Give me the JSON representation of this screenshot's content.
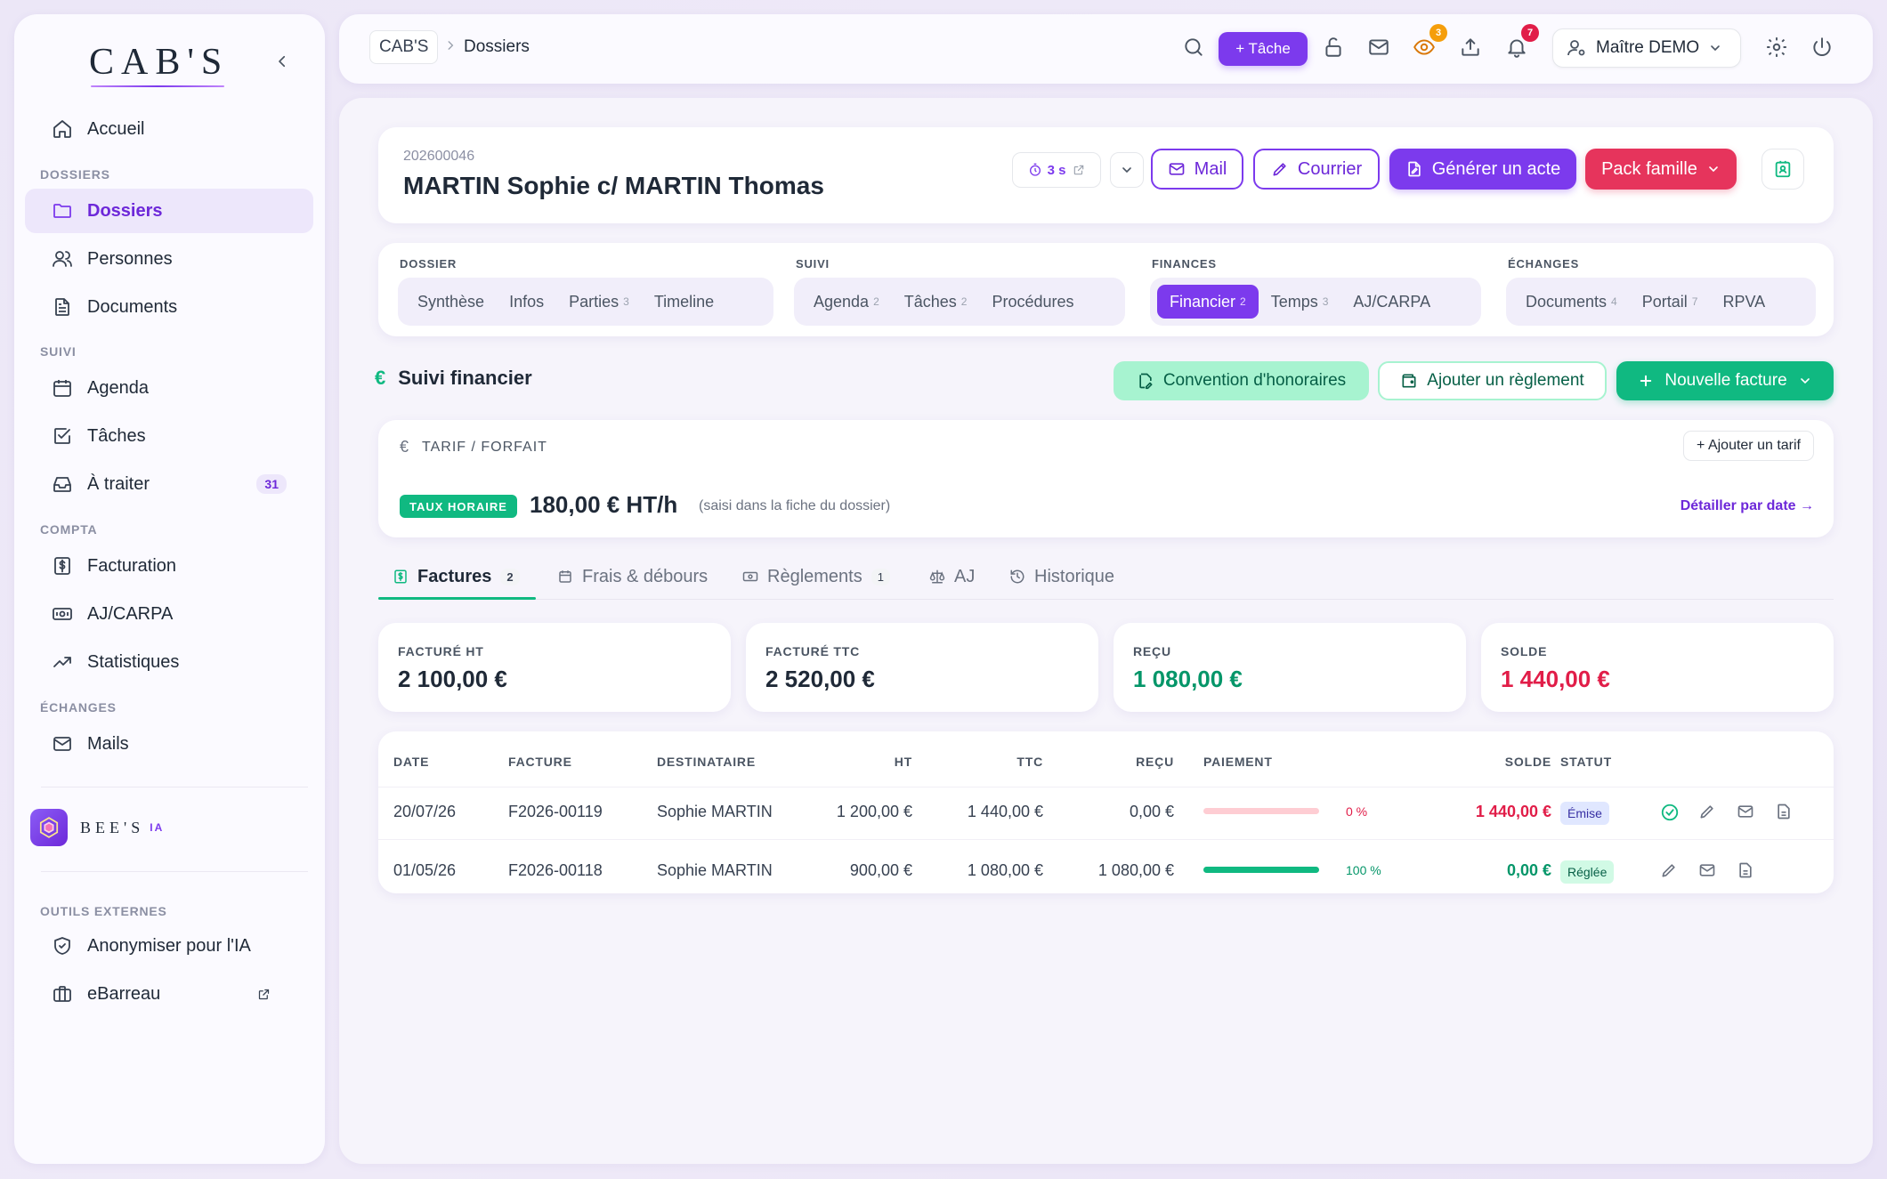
{
  "sidebar": {
    "logo": "CAB'S",
    "items": [
      {
        "label": "Accueil",
        "icon": "home-icon"
      },
      {
        "group": "DOSSIERS"
      },
      {
        "label": "Dossiers",
        "icon": "folder-icon",
        "active": true
      },
      {
        "label": "Personnes",
        "icon": "users-icon"
      },
      {
        "label": "Documents",
        "icon": "document-icon"
      },
      {
        "group": "SUIVI"
      },
      {
        "label": "Agenda",
        "icon": "calendar-icon"
      },
      {
        "label": "Tâches",
        "icon": "checkbox-icon"
      },
      {
        "label": "À traiter",
        "icon": "inbox-icon",
        "badge": "31"
      },
      {
        "group": "COMPTA"
      },
      {
        "label": "Facturation",
        "icon": "invoice-icon"
      },
      {
        "label": "AJ/CARPA",
        "icon": "banknote-icon"
      },
      {
        "label": "Statistiques",
        "icon": "trend-icon"
      },
      {
        "group": "ÉCHANGES"
      },
      {
        "label": "Mails",
        "icon": "mail-icon"
      }
    ],
    "groups": {
      "dossiers": "DOSSIERS",
      "suivi": "SUIVI",
      "compta": "COMPTA",
      "echanges": "ÉCHANGES",
      "outils": "OUTILS EXTERNES"
    },
    "labels": {
      "accueil": "Accueil",
      "dossiers": "Dossiers",
      "personnes": "Personnes",
      "documents": "Documents",
      "agenda": "Agenda",
      "taches": "Tâches",
      "a_traiter": "À traiter",
      "a_traiter_badge": "31",
      "facturation": "Facturation",
      "ajcarpa": "AJ/CARPA",
      "statistiques": "Statistiques",
      "mails": "Mails",
      "anonymiser": "Anonymiser pour l'IA",
      "ebarreau": "eBarreau"
    },
    "bees": {
      "name": "BEE'S",
      "suffix": "IA"
    }
  },
  "topbar": {
    "breadcrumb_root": "CAB'S",
    "breadcrumb_current": "Dossiers",
    "tache_button": "+ Tâche",
    "eye_badge": "3",
    "bell_badge": "7",
    "user": "Maître DEMO"
  },
  "dossier": {
    "number": "202600046",
    "title": "MARTIN Sophie c/ MARTIN Thomas",
    "timer": "3 s",
    "buttons": {
      "mail": "Mail",
      "courrier": "Courrier",
      "generer": "Générer un acte",
      "pack": "Pack famille"
    }
  },
  "tabgroups": {
    "dossier": {
      "label": "DOSSIER",
      "tabs": {
        "synthese": "Synthèse",
        "infos": "Infos",
        "parties": "Parties",
        "parties_count": "3",
        "timeline": "Timeline"
      }
    },
    "suivi": {
      "label": "SUIVI",
      "tabs": {
        "agenda": "Agenda",
        "agenda_count": "2",
        "taches": "Tâches",
        "taches_count": "2",
        "procedures": "Procédures"
      }
    },
    "finances": {
      "label": "FINANCES",
      "tabs": {
        "financier": "Financier",
        "financier_count": "2",
        "temps": "Temps",
        "temps_count": "3",
        "ajcarpa": "AJ/CARPA"
      }
    },
    "echanges": {
      "label": "ÉCHANGES",
      "tabs": {
        "documents": "Documents",
        "documents_count": "4",
        "portail": "Portail",
        "portail_count": "7",
        "rpva": "RPVA"
      }
    }
  },
  "suivi_financier": {
    "title": "Suivi financier",
    "convention": "Convention d'honoraires",
    "ajouter_reglement": "Ajouter un règlement",
    "nouvelle_facture": "Nouvelle facture"
  },
  "tarif": {
    "label": "TARIF / FORFAIT",
    "add": "+ Ajouter un tarif",
    "badge": "TAUX HORAIRE",
    "value": "180,00 € HT/h",
    "note": "(saisi dans la fiche du dossier)",
    "detail": "Détailler par date →"
  },
  "subtabs": {
    "factures": "Factures",
    "factures_count": "2",
    "frais": "Frais & débours",
    "reglements": "Règlements",
    "reglements_count": "1",
    "aj": "AJ",
    "historique": "Historique"
  },
  "summary": {
    "facture_ht": {
      "label": "FACTURÉ HT",
      "value": "2 100,00 €"
    },
    "facture_ttc": {
      "label": "FACTURÉ TTC",
      "value": "2 520,00 €"
    },
    "recu": {
      "label": "REÇU",
      "value": "1 080,00 €"
    },
    "solde": {
      "label": "SOLDE",
      "value": "1 440,00 €"
    }
  },
  "invoices": {
    "columns": {
      "date": "DATE",
      "facture": "FACTURE",
      "destinataire": "DESTINATAIRE",
      "ht": "HT",
      "ttc": "TTC",
      "recu": "REÇU",
      "paiement": "PAIEMENT",
      "solde": "SOLDE",
      "statut": "STATUT"
    },
    "rows": [
      {
        "date": "20/07/26",
        "facture": "F2026-00119",
        "destinataire": "Sophie MARTIN",
        "ht": "1 200,00 €",
        "ttc": "1 440,00 €",
        "recu": "0,00 €",
        "paiement_pct": 0,
        "paiement_text": "0 %",
        "solde": "1 440,00 €",
        "statut": "Émise"
      },
      {
        "date": "01/05/26",
        "facture": "F2026-00118",
        "destinataire": "Sophie MARTIN",
        "ht": "900,00 €",
        "ttc": "1 080,00 €",
        "recu": "1 080,00 €",
        "paiement_pct": 100,
        "paiement_text": "100 %",
        "solde": "0,00 €",
        "statut": "Réglée"
      }
    ]
  },
  "colors": {
    "accent": "#7c3aed",
    "green": "#10b981",
    "red": "#e11d48",
    "pink": "#e6345c"
  }
}
